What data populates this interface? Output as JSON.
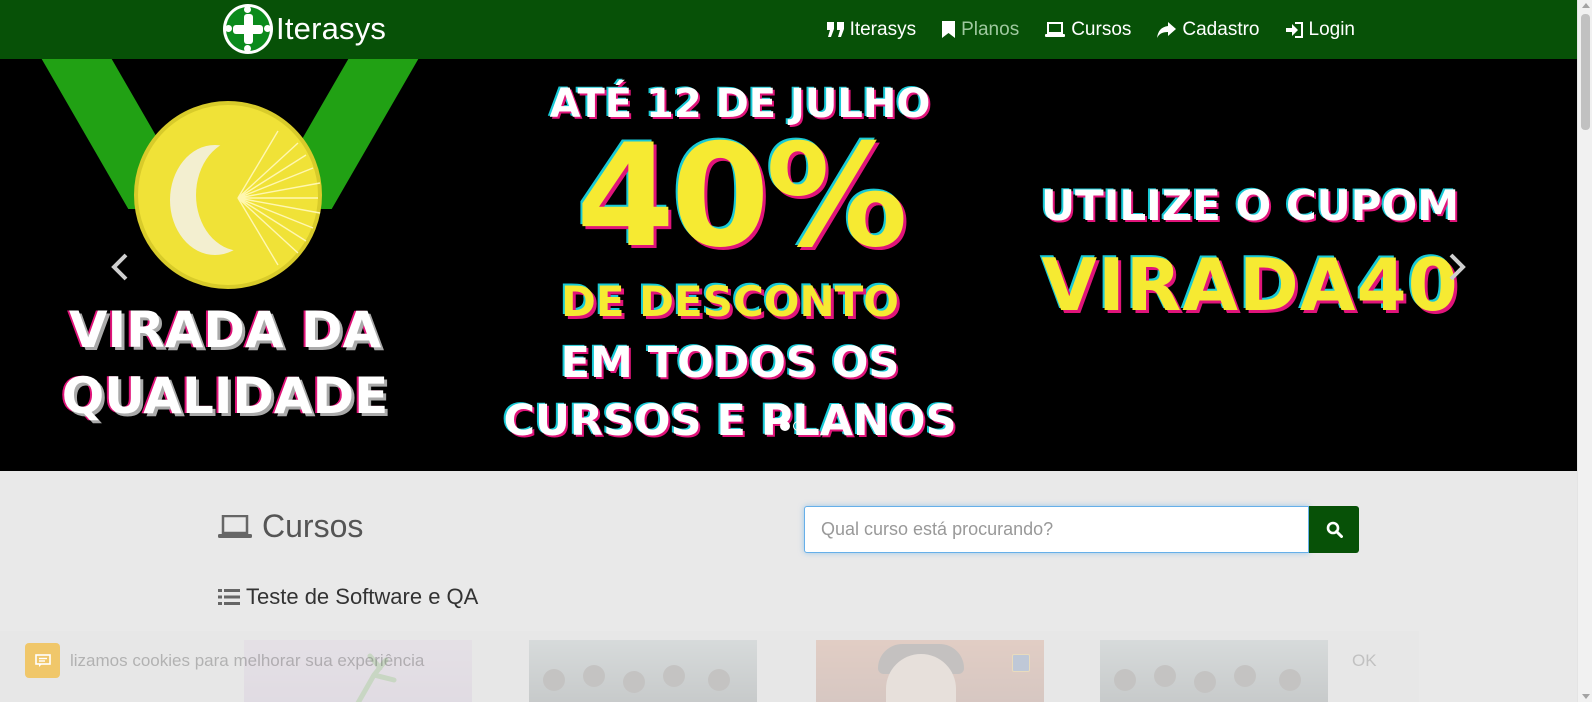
{
  "brand": {
    "name": "Iterasys"
  },
  "nav": {
    "items": [
      {
        "label": "Iterasys",
        "icon": "quote-icon",
        "active": false
      },
      {
        "label": "Planos",
        "icon": "bookmark-icon",
        "active": true
      },
      {
        "label": "Cursos",
        "icon": "laptop-icon",
        "active": false
      },
      {
        "label": "Cadastro",
        "icon": "share-icon",
        "active": false
      },
      {
        "label": "Login",
        "icon": "sign-in-icon",
        "active": false
      }
    ]
  },
  "banner": {
    "left_line1": "VIRADA DA",
    "left_line2": "QUALIDADE",
    "until": "ATÉ 12 DE JULHO",
    "percent": "40%",
    "discount": "DE DESCONTO",
    "all_line1": "EM TODOS OS",
    "all_line2": "CURSOS E PLANOS",
    "use_coupon": "UTILIZE O CUPOM",
    "coupon": "VIRADA40"
  },
  "courses": {
    "title": "Cursos",
    "search_placeholder": "Qual curso está procurando?",
    "category": "Teste de Software e QA"
  },
  "cookie": {
    "text": "lizamos cookies para melhorar sua experiência",
    "ok": "OK"
  },
  "colors": {
    "navbar": "#075107",
    "accent_yellow": "#f6ea32",
    "ribbon_green": "#21a114"
  }
}
